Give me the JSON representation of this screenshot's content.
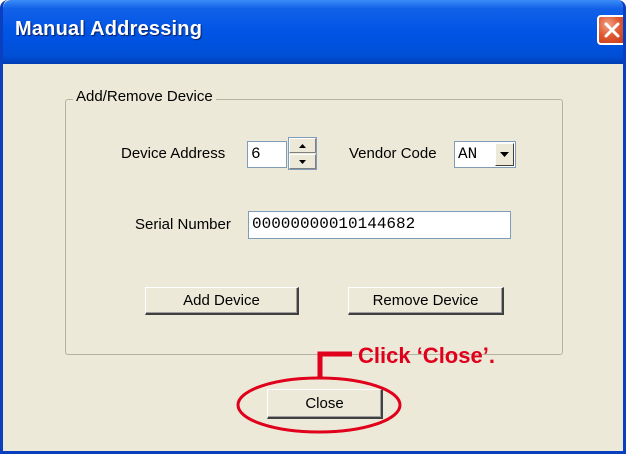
{
  "window": {
    "title": "Manual Addressing",
    "close_icon": "close-x-icon"
  },
  "group": {
    "label": "Add/Remove Device"
  },
  "device_address": {
    "label": "Device Address",
    "value": "6",
    "spinner_icons": [
      "spin-up-icon",
      "spin-down-icon"
    ]
  },
  "vendor_code": {
    "label": "Vendor Code",
    "value": "AN",
    "dropdown_icon": "chevron-down-icon"
  },
  "serial_number": {
    "label": "Serial Number",
    "value": "00000000010144682"
  },
  "buttons": {
    "add": "Add Device",
    "remove": "Remove Device",
    "close": "Close"
  },
  "annotation": {
    "text": "Click ‘Close’.",
    "color": "#e0001b"
  },
  "colors": {
    "titlebar": "#0055e5",
    "dialog_background": "#ece9d8",
    "close_button": "#e05a32"
  }
}
